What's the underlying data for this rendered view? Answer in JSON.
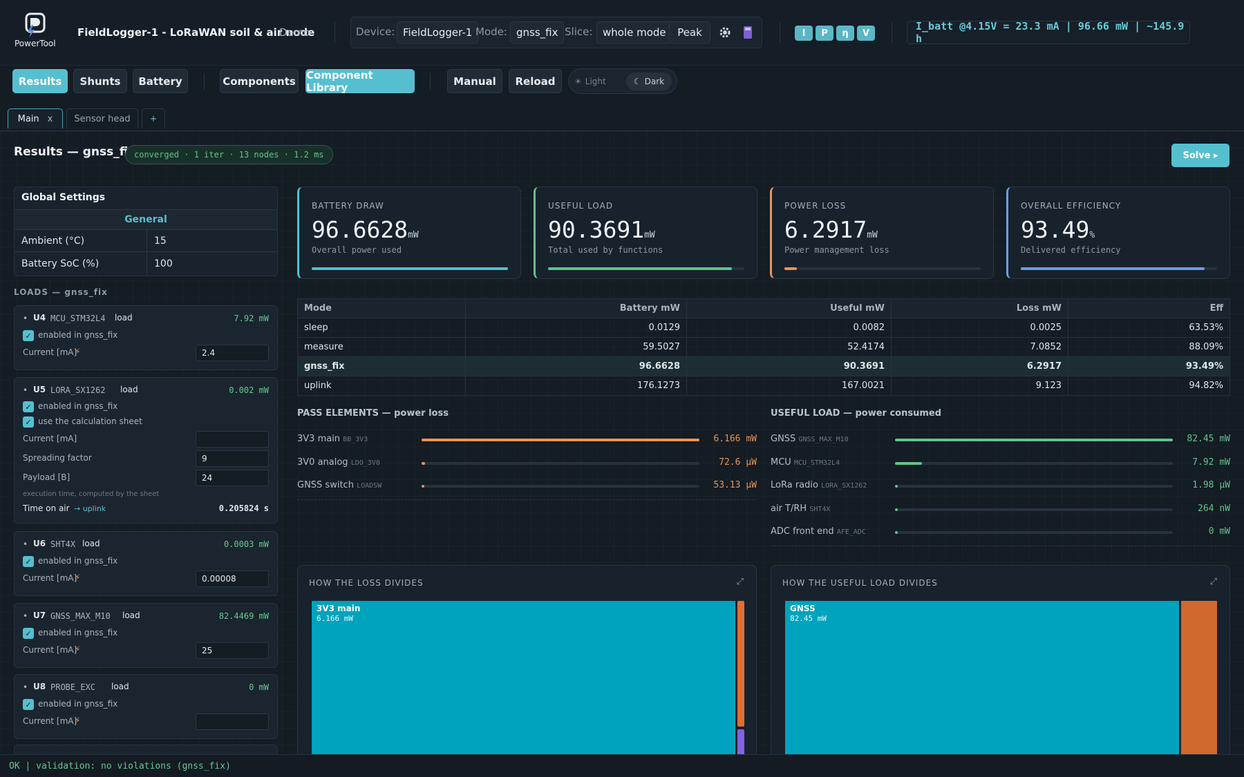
{
  "app": {
    "logo_text": "PowerTool",
    "title": "FieldLogger-1 - LoRaWAN soil & air node",
    "badge": "Demo"
  },
  "device_bar": {
    "device_label": "Device:",
    "device_value": "FieldLogger-1",
    "mode_label": "Mode:",
    "mode_value": "gnss_fix",
    "slice_label": "Slice:",
    "slice_value": "whole mode",
    "peak_label": "Peak"
  },
  "quick_badges": [
    "I",
    "P",
    "η",
    "V"
  ],
  "battery_readout": "I_batt @4.15V = 23.3 mA | 96.66 mW | ~145.9 h",
  "nav": {
    "results": "Results",
    "shunts": "Shunts",
    "battery": "Battery",
    "components": "Components",
    "component_library": "Component Library",
    "manual": "Manual",
    "reload": "Reload",
    "theme_light": "Light",
    "theme_dark": "Dark"
  },
  "tabs": {
    "main": "Main",
    "main_close": "x",
    "sensor_head": "Sensor head",
    "add": "+"
  },
  "results": {
    "title": "Results — gnss_fix",
    "status": "converged · 1 iter · 13 nodes · 1.2 ms",
    "solve": "Solve ▸"
  },
  "global_settings": {
    "title": "Global Settings",
    "section": "General",
    "rows": [
      {
        "label": "Ambient (°C)",
        "value": "15"
      },
      {
        "label": "Battery SoC (%)",
        "value": "100"
      }
    ]
  },
  "loads_header": "LOADS — gnss_fix",
  "loads": [
    {
      "ref": "U4",
      "part": "MCU_STM32L4",
      "kind": "load",
      "power": "7.92 mW",
      "enabled": "enabled in gnss_fix",
      "current_label": "Current [mA]",
      "current_value": "2.4"
    },
    {
      "ref": "U5",
      "part": "LORA_SX1262",
      "kind": "load",
      "power": "0.002 mW",
      "enabled": "enabled in gnss_fix",
      "calc_sheet": "use the calculation sheet",
      "current_label": "Current [mA]",
      "current_value": "",
      "sf_label": "Spreading factor",
      "sf_value": "9",
      "payload_label": "Payload [B]",
      "payload_value": "24",
      "note": "execution time, computed by the sheet",
      "toa_label": "Time on air",
      "toa_link": "→ uplink",
      "toa_value": "0.205824 s"
    },
    {
      "ref": "U6",
      "part": "SHT4X",
      "kind": "load",
      "power": "0.0003 mW",
      "enabled": "enabled in gnss_fix",
      "current_label": "Current [mA]",
      "current_value": "0.00008"
    },
    {
      "ref": "U7",
      "part": "GNSS_MAX_M10",
      "kind": "load",
      "power": "82.4469 mW",
      "enabled": "enabled in gnss_fix",
      "current_label": "Current [mA]",
      "current_value": "25"
    },
    {
      "ref": "U8",
      "part": "PROBE_EXC",
      "kind": "load",
      "power": "0 mW",
      "enabled": "enabled in gnss_fix",
      "current_label": "Current [mA]",
      "current_value": ""
    }
  ],
  "stats": [
    {
      "label": "BATTERY DRAW",
      "value": "96.6628",
      "unit": "mW",
      "sub": "Overall power used",
      "fill": 1.0,
      "color": "#4fc0d0"
    },
    {
      "label": "USEFUL LOAD",
      "value": "90.3691",
      "unit": "mW",
      "sub": "Total used by functions",
      "fill": 0.935,
      "color": "#62c38a"
    },
    {
      "label": "POWER LOSS",
      "value": "6.2917",
      "unit": "mW",
      "sub": "Power management loss",
      "fill": 0.065,
      "color": "#e8935a"
    },
    {
      "label": "OVERALL EFFICIENCY",
      "value": "93.49",
      "unit": "%",
      "sub": "Delivered efficiency",
      "fill": 0.9349,
      "color": "#6e9ee6"
    }
  ],
  "mode_table": {
    "headers": [
      "Mode",
      "Battery mW",
      "Useful mW",
      "Loss mW",
      "Eff"
    ],
    "rows": [
      [
        "sleep",
        "0.0129",
        "0.0082",
        "0.0025",
        "63.53%"
      ],
      [
        "measure",
        "59.5027",
        "52.4174",
        "7.0852",
        "88.09%"
      ],
      [
        "gnss_fix",
        "96.6628",
        "90.3691",
        "6.2917",
        "93.49%"
      ],
      [
        "uplink",
        "176.1273",
        "167.0021",
        "9.123",
        "94.82%"
      ]
    ]
  },
  "pass_elements": {
    "title": "PASS ELEMENTS — power loss",
    "items": [
      {
        "name": "3V3 main",
        "part": "BB_3V3",
        "value": "6.166 mW",
        "fill": 1.0
      },
      {
        "name": "3V0 analog",
        "part": "LDO_3V0",
        "value": "72.6 µW",
        "fill": 0.012
      },
      {
        "name": "GNSS switch",
        "part": "LOADSW",
        "value": "53.13 µW",
        "fill": 0.009
      }
    ]
  },
  "useful_load": {
    "title": "USEFUL LOAD — power consumed",
    "items": [
      {
        "name": "GNSS",
        "part": "GNSS_MAX_M10",
        "value": "82.45 mW",
        "fill": 1.0
      },
      {
        "name": "MCU",
        "part": "MCU_STM32L4",
        "value": "7.92 mW",
        "fill": 0.096
      },
      {
        "name": "LoRa radio",
        "part": "LORA_SX1262",
        "value": "1.98 µW",
        "fill": 0.006
      },
      {
        "name": "air T/RH",
        "part": "SHT4X",
        "value": "264 nW",
        "fill": 0.004
      },
      {
        "name": "ADC front end",
        "part": "AFE_ADC",
        "value": "0 mW",
        "fill": 0.003
      }
    ]
  },
  "loss_treemap": {
    "title": "HOW THE LOSS DIVIDES",
    "main_label": "3V3 main",
    "main_value": "6.166 mW"
  },
  "useful_treemap": {
    "title": "HOW THE USEFUL LOAD DIVIDES",
    "main_label": "GNSS",
    "main_value": "82.45 mW"
  },
  "status_bar": "OK | validation: no violations (gnss_fix)",
  "colors": {
    "accent": "#56bfcf",
    "green": "#62c38a",
    "orange": "#e8935a",
    "blue": "#6e9ee6",
    "teal_treemap": "#00a3bd"
  }
}
